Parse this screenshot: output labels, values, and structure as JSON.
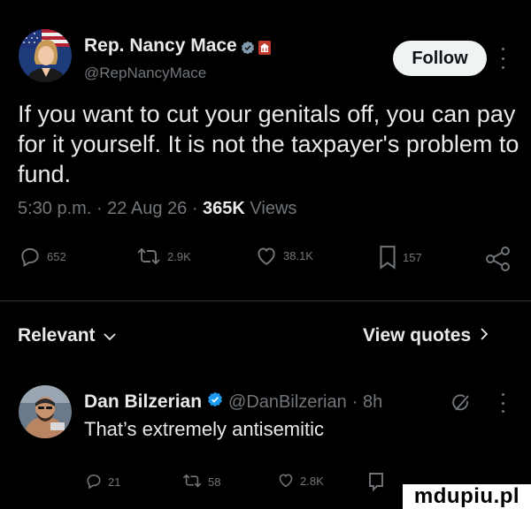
{
  "post": {
    "author_name": "Rep. Nancy Mace",
    "author_handle": "@RepNancyMace",
    "follow_label": "Follow",
    "text": "If you want to cut your genitals off, you can pay for it yourself. It is not the taxpayer's problem to fund.",
    "time": "5:30 p.m.",
    "date": "22 Aug 26",
    "views_count": "365K",
    "views_label": "Views",
    "replies": "652",
    "reposts": "2.9K",
    "likes": "38.1K",
    "bookmarks": "157"
  },
  "relevant": {
    "label": "Relevant",
    "view_quotes_label": "View quotes"
  },
  "reply": {
    "author_name": "Dan Bilzerian",
    "author_handle": "@DanBilzerian",
    "age": "· 8h",
    "text": "That’s extremely antisemitic",
    "replies": "21",
    "reposts": "58",
    "likes": "2.8K"
  },
  "watermark": "mdupiu.pl",
  "colors": {
    "background": "#000000",
    "text": "#e7e9ea",
    "secondary": "#71767b",
    "verified": "#1d9bf0",
    "divider": "#2f3336"
  }
}
